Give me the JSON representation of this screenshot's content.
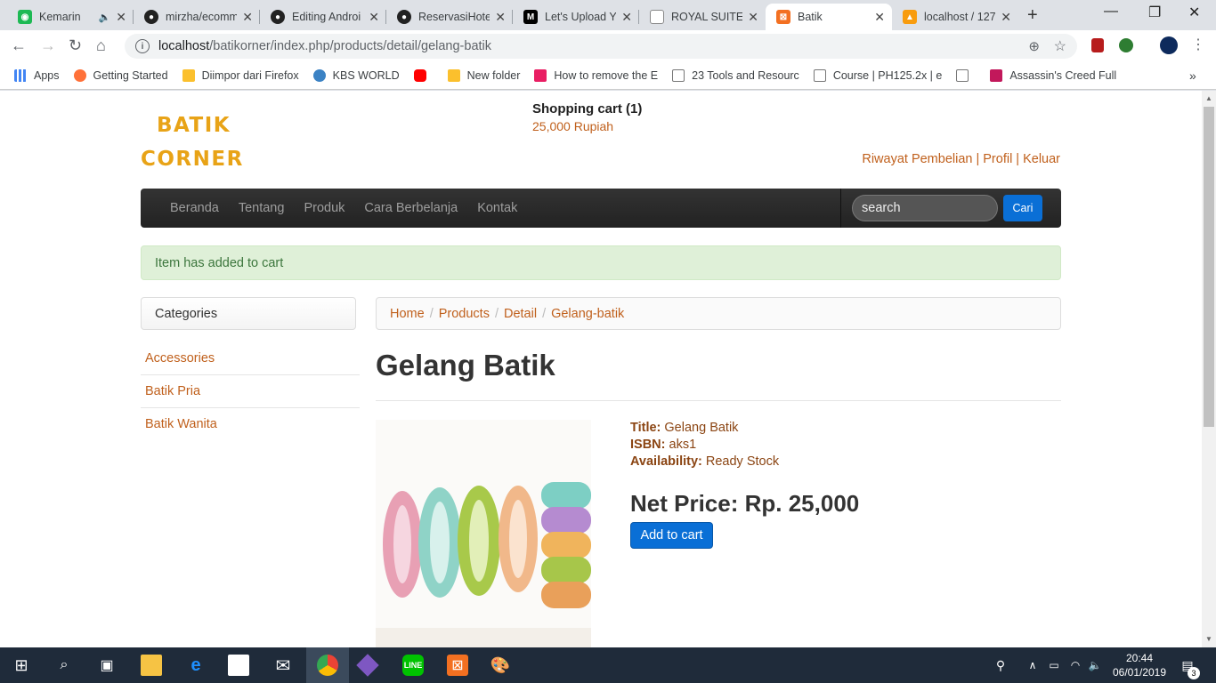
{
  "browser": {
    "tabs": [
      {
        "title": "Kemarin",
        "icon": "spotify-like-icon",
        "color": "#1db954"
      },
      {
        "title": "mirzha/ecomm",
        "icon": "github-icon",
        "color": "#222222"
      },
      {
        "title": "Editing Androi",
        "icon": "github-icon",
        "color": "#222222"
      },
      {
        "title": "ReservasiHotel",
        "icon": "github-icon",
        "color": "#222222"
      },
      {
        "title": "Let's Upload Yo",
        "icon": "medium-icon",
        "color": "#000000"
      },
      {
        "title": "ROYAL SUITE",
        "icon": "document-icon",
        "color": "#888888"
      },
      {
        "title": "Batik",
        "icon": "xampp-icon",
        "color": "#f37021"
      },
      {
        "title": "localhost / 127",
        "icon": "phpmyadmin-icon",
        "color": "#f89c0e"
      }
    ],
    "active_tab_index": 6,
    "new_tab": "+",
    "url_host": "localhost",
    "url_path": "/batikorner/index.php/products/detail/gelang-batik",
    "bookmarks": [
      {
        "label": "Apps",
        "color": "#4285f4"
      },
      {
        "label": "Getting Started",
        "color": "#ff7139"
      },
      {
        "label": "Diimpor dari Firefox",
        "color": "#fbc02d"
      },
      {
        "label": "KBS WORLD",
        "color": "#3b82c4"
      },
      {
        "label": "",
        "color": "#ff0000"
      },
      {
        "label": "New folder",
        "color": "#fbc02d"
      },
      {
        "label": "How to remove the E",
        "color": "#e91e63"
      },
      {
        "label": "23 Tools and Resourc",
        "color": "#9e9e9e"
      },
      {
        "label": "Course | PH125.2x | e",
        "color": "#9e9e9e"
      },
      {
        "label": "",
        "color": "#9e9e9e"
      },
      {
        "label": "Assassin's Creed Full",
        "color": "#c2185b"
      }
    ],
    "more_bookmarks": "»"
  },
  "site": {
    "logo_line1": "BATIK",
    "logo_line2": "CORNER",
    "cart_title": "Shopping cart (1)",
    "cart_value": "25,000 Rupiah",
    "user_links": [
      "Riwayat Pembelian",
      "Profil",
      "Keluar"
    ],
    "user_links_sep": "|",
    "nav": [
      "Beranda",
      "Tentang",
      "Produk",
      "Cara Berbelanja",
      "Kontak"
    ],
    "search_placeholder": "search",
    "search_button": "Cari",
    "alert": "Item has added to cart",
    "categories_title": "Categories",
    "categories": [
      "Accessories",
      "Batik Pria",
      "Batik Wanita"
    ],
    "breadcrumb": [
      "Home",
      "Products",
      "Detail",
      "Gelang-batik"
    ],
    "breadcrumb_sep": "/"
  },
  "product": {
    "name": "Gelang Batik",
    "title_label": "Title:",
    "title_value": "Gelang Batik",
    "isbn_label": "ISBN:",
    "isbn_value": "aks1",
    "availability_label": "Availability:",
    "availability_value": "Ready Stock",
    "price": "Net Price: Rp. 25,000",
    "add_to_cart": "Add to cart"
  },
  "taskbar": {
    "time": "20:44",
    "date": "06/01/2019",
    "notifications": "3"
  }
}
